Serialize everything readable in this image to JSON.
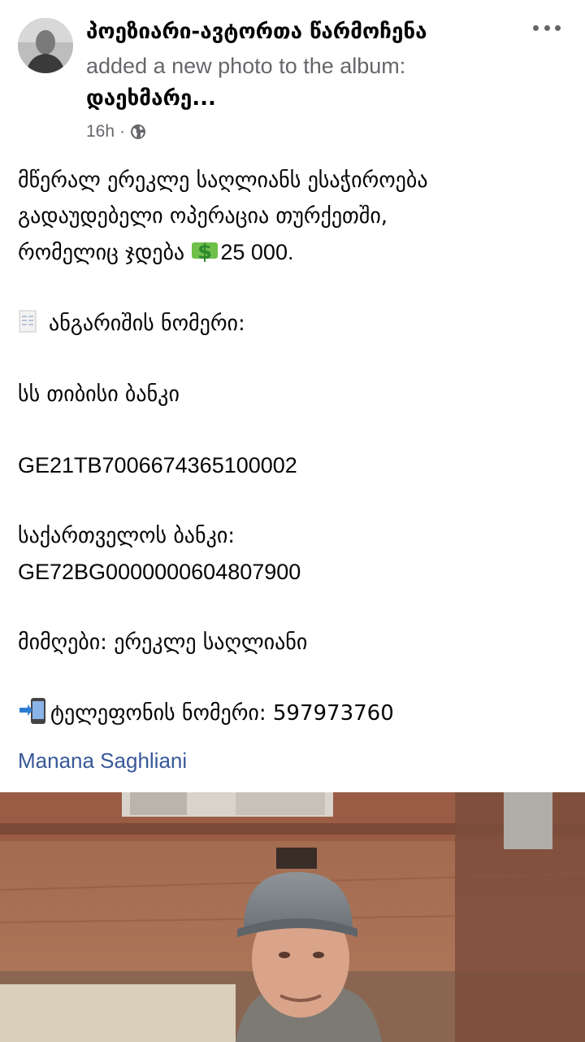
{
  "post": {
    "author": "პოეზიარი-ავტორთა წარმოჩენა",
    "action": "added a new photo to the album:",
    "album": "დაეხმარე...",
    "time": "16h",
    "separator": "·",
    "privacy_icon": "globe-icon",
    "more_icon": "more-options-icon"
  },
  "body": {
    "line1": "მწერალ ერეკლე საღლიანს ესაჭიროება",
    "line2": "გადაუდებელი ოპერაცია თურქეთში,",
    "line3_text": "რომელიც ჯდება ",
    "line3_amount": "25 000.",
    "account_label": "ანგარიშის ნომერი:",
    "bank1_name": "სს თიბისი ბანკი",
    "bank1_iban": "GE21TB7006674365100002",
    "bank2_name": "საქართველოს ბანკი:",
    "bank2_iban": "GE72BG0000000604807900",
    "recipient": "მიმღები: ერეკლე საღლიანი",
    "phone": "ტელეფონის ნომერი: 597973760"
  },
  "tag": "Manana Saghliani",
  "colors": {
    "link": "#385898",
    "secondary_text": "#65676b",
    "primary_text": "#050505"
  }
}
